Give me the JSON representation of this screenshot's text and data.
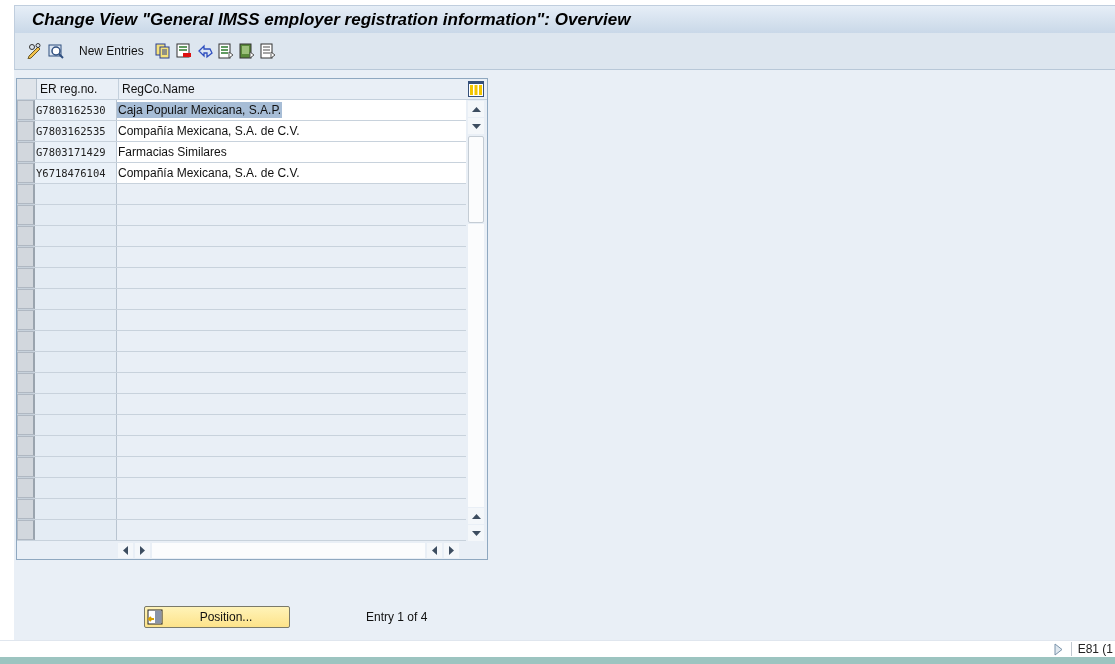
{
  "window": {
    "title": "Change View \"General IMSS employer registration information\": Overview"
  },
  "toolbar": {
    "new_entries": "New Entries"
  },
  "table": {
    "columns": [
      "ER reg.no.",
      "RegCo.Name"
    ],
    "rows": [
      {
        "reg_no": "G7803162530",
        "name": "Caja Popular Mexicana, S.A.P.",
        "selected": true
      },
      {
        "reg_no": "G7803162535",
        "name": "Compañía Mexicana, S.A. de C.V.",
        "selected": false
      },
      {
        "reg_no": "G7803171429",
        "name": "Farmacias Similares",
        "selected": false
      },
      {
        "reg_no": "Y6718476104",
        "name": "Compañía Mexicana, S.A. de C.V.",
        "selected": false
      }
    ]
  },
  "position_button": "Position...",
  "entry_info": "Entry 1 of 4",
  "status_bar": {
    "system": "E81 (1"
  }
}
